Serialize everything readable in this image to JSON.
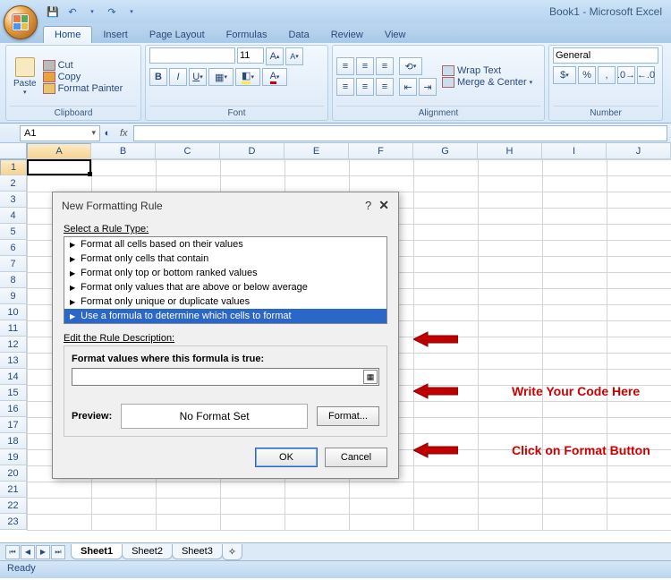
{
  "app": {
    "title": "Book1 - Microsoft Excel"
  },
  "qat": {
    "save": "💾",
    "undo": "↶",
    "redo": "↷",
    "more": "▾"
  },
  "tabs": [
    "Home",
    "Insert",
    "Page Layout",
    "Formulas",
    "Data",
    "Review",
    "View"
  ],
  "ribbon": {
    "clipboard": {
      "label": "Clipboard",
      "paste": "Paste",
      "cut": "Cut",
      "copy": "Copy",
      "fp": "Format Painter"
    },
    "font": {
      "label": "Font",
      "name": "",
      "size": "11",
      "grow": "A",
      "shrink": "A"
    },
    "align": {
      "label": "Alignment",
      "wrap": "Wrap Text",
      "merge": "Merge & Center"
    },
    "number": {
      "label": "Number",
      "format": "General",
      "cur": "$",
      "pct": "%",
      "comma": ",",
      "inc": "",
      "dec": ""
    }
  },
  "namebox": {
    "ref": "A1",
    "fx": "fx"
  },
  "cols": [
    "A",
    "B",
    "C",
    "D",
    "E",
    "F",
    "G",
    "H",
    "I",
    "J"
  ],
  "rows": [
    "1",
    "2",
    "3",
    "4",
    "5",
    "6",
    "7",
    "8",
    "9",
    "10",
    "11",
    "12",
    "13",
    "14",
    "15",
    "16",
    "17",
    "18",
    "19",
    "20",
    "21",
    "22",
    "23"
  ],
  "dialog": {
    "title": "New Formatting Rule",
    "help": "?",
    "close": "✕",
    "select_label": "Select a Rule Type:",
    "rules": [
      "Format all cells based on their values",
      "Format only cells that contain",
      "Format only top or bottom ranked values",
      "Format only values that are above or below average",
      "Format only unique or duplicate values",
      "Use a formula to determine which cells to format"
    ],
    "selected_rule_index": 5,
    "edit_label": "Edit the Rule Description:",
    "formula_label": "Format values where this formula is true:",
    "formula_value": "",
    "preview_label": "Preview:",
    "preview_text": "No Format Set",
    "format_btn": "Format...",
    "ok": "OK",
    "cancel": "Cancel"
  },
  "annotations": {
    "a1": "",
    "a2": "Write Your Code Here",
    "a3": "Click on Format Button"
  },
  "sheets": {
    "tabs": [
      "Sheet1",
      "Sheet2",
      "Sheet3"
    ],
    "active": 0,
    "new": "+"
  },
  "status": "Ready"
}
